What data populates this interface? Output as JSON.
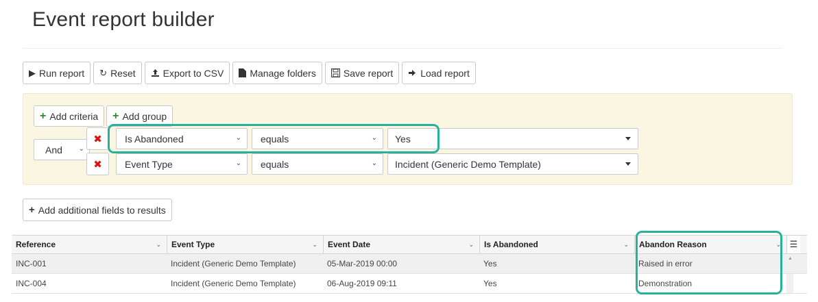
{
  "page": {
    "title": "Event report builder"
  },
  "toolbar": {
    "run_report": "Run report",
    "reset": "Reset",
    "export_csv": "Export to CSV",
    "manage_folders": "Manage folders",
    "save_report": "Save report",
    "load_report": "Load report"
  },
  "criteria": {
    "add_criteria": "Add criteria",
    "add_group": "Add group",
    "conjunction": "And",
    "rows": [
      {
        "field": "Is Abandoned",
        "operator": "equals",
        "value": "Yes"
      },
      {
        "field": "Event Type",
        "operator": "equals",
        "value": "Incident (Generic Demo Template)"
      }
    ]
  },
  "add_fields_label": "Add additional fields to results",
  "grid": {
    "columns": [
      "Reference",
      "Event Type",
      "Event Date",
      "Is Abandoned",
      "Abandon Reason"
    ],
    "rows": [
      [
        "INC-001",
        "Incident (Generic Demo Template)",
        "05-Mar-2019 00:00",
        "Yes",
        "Raised in error"
      ],
      [
        "INC-004",
        "Incident (Generic Demo Template)",
        "06-Aug-2019 09:11",
        "Yes",
        "Demonstration"
      ]
    ]
  },
  "colors": {
    "highlight": "#27b19a",
    "panel_bg": "#fbf6e2",
    "delete": "#dd1111",
    "add": "#2c8a2c"
  },
  "icons": {
    "run": "play-icon",
    "reset": "refresh-icon",
    "export": "upload-icon",
    "folders": "file-icon",
    "save": "save-icon",
    "load": "sign-in-icon",
    "add": "plus-icon",
    "delete": "times-icon",
    "column_menu": "hamburger-menu-icon"
  }
}
